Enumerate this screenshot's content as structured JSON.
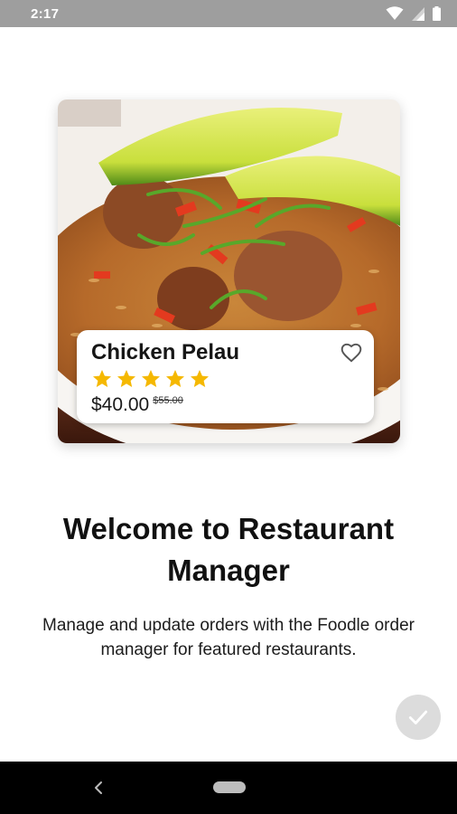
{
  "status_bar": {
    "time": "2:17",
    "icons": [
      "wifi-icon",
      "signal-icon",
      "battery-icon"
    ],
    "background": "#9e9e9e"
  },
  "card": {
    "food_name": "Chicken Pelau",
    "rating": 5,
    "rating_max": 5,
    "price": "$40.00",
    "old_price": "$55.00",
    "star_color": "#f5b800"
  },
  "welcome": {
    "title": "Welcome to Restaurant Manager",
    "description": "Manage and update orders with the Foodle order manager for featured restaurants."
  },
  "done_button": {
    "icon": "check-icon",
    "color": "#dcdcdc"
  },
  "nav_bar": {
    "icons": [
      "back-icon",
      "home-pill"
    ]
  }
}
